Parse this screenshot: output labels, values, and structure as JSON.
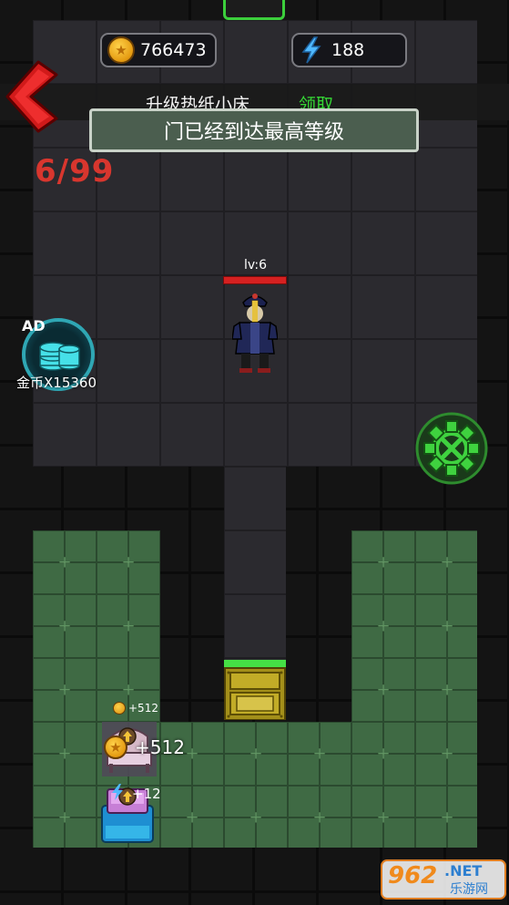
{
  "hud": {
    "coins": "766473",
    "energy": "188",
    "coin_icon": "gold-coin-icon",
    "energy_icon": "lightning-icon"
  },
  "level_up": {
    "label": "升级热纸小床",
    "claim_label": "领取"
  },
  "toast": "门已经到达最高等级",
  "wave": "6/99",
  "ad_offer": {
    "badge": "AD",
    "reward": "金币X15360"
  },
  "enemy": {
    "level": "lv:6",
    "hp_fraction": 1.0
  },
  "floaters": {
    "small_coin": "+512",
    "bed_coin": "+512",
    "energy": "+12"
  },
  "watermark": {
    "brand": "962",
    "suffix": ".NET",
    "site": "乐游网"
  },
  "colors": {
    "claim_green": "#35d835",
    "wave_red": "#d8362e",
    "door_gold": "#b8a31e",
    "ad_cyan": "#2fa7b4",
    "settings_green": "#3fd23f"
  }
}
